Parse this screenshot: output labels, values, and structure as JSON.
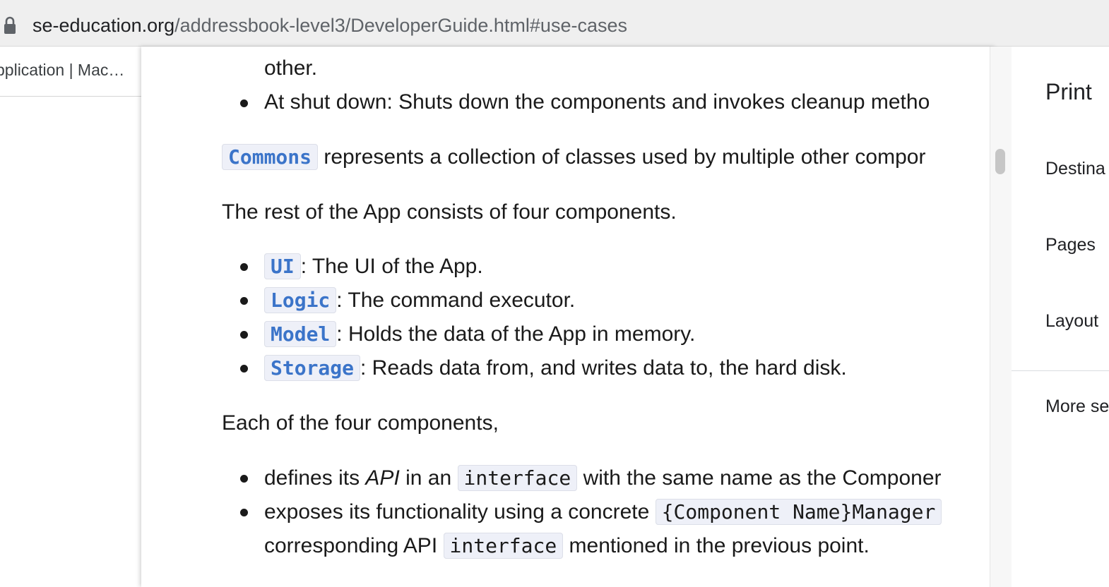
{
  "browser": {
    "url_host": "se-education.org",
    "url_path": "/addressbook-level3/DeveloperGuide.html#use-cases",
    "background_tab_label": "pplication | Mac…"
  },
  "document": {
    "line_other": "other.",
    "shutdown_text": "At shut down: Shuts down the components and invokes cleanup metho",
    "commons_code": "Commons",
    "commons_text": "represents a collection of classes used by multiple other compor",
    "rest_intro": "The rest of the App consists of four components.",
    "components": [
      {
        "code": "UI",
        "desc": ": The UI of the App."
      },
      {
        "code": "Logic",
        "desc": ": The command executor."
      },
      {
        "code": "Model",
        "desc": ": Holds the data of the App in memory."
      },
      {
        "code": "Storage",
        "desc": ": Reads data from, and writes data to, the hard disk."
      }
    ],
    "each_intro": "Each of the four components,",
    "defines_prefix": "defines its ",
    "defines_api": "API",
    "defines_mid": " in an ",
    "defines_code": "interface",
    "defines_suffix": " with the same name as the Componer",
    "exposes_prefix": "exposes its functionality using a concrete ",
    "exposes_code": "{Component Name}Manager",
    "corresponding_prefix": "corresponding API ",
    "corresponding_code": "interface",
    "corresponding_suffix": " mentioned in the previous point."
  },
  "print_panel": {
    "title": "Print",
    "destination_label": "Destina",
    "pages_label": "Pages",
    "layout_label": "Layout",
    "more_settings_label": "More se"
  },
  "colors": {
    "link_code": "#3b74c9",
    "code_background": "#eef0f8",
    "url_bar": "#efefef"
  }
}
